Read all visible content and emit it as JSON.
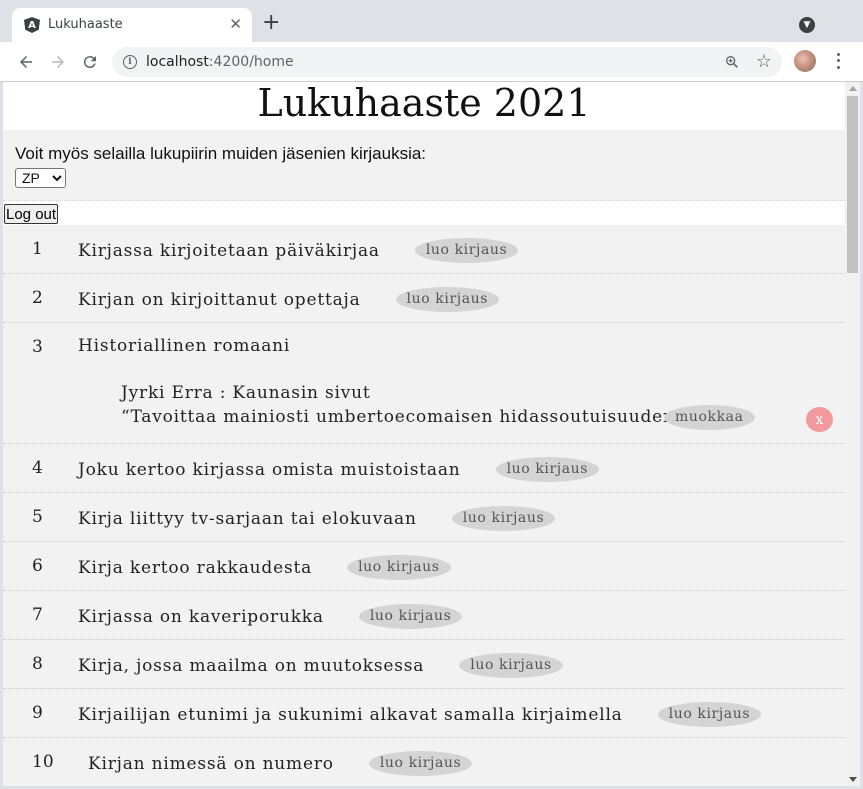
{
  "browser": {
    "tab_title": "Lukuhaaste",
    "tab_favicon": "A",
    "url_host": "localhost",
    "url_path": ":4200/home"
  },
  "page": {
    "title": "Lukuhaaste 2021",
    "intro_text": "Voit myös selailla lukupiirin muiden jäsenien kirjauksia:",
    "member_select": {
      "selected": "ZP",
      "options": [
        "ZP"
      ]
    },
    "logout_label": "Log out",
    "create_label": "luo kirjaus",
    "edit_label": "muokkaa",
    "delete_label": "x"
  },
  "challenges": [
    {
      "num": "1",
      "title": "Kirjassa kirjoitetaan päiväkirjaa"
    },
    {
      "num": "2",
      "title": "Kirjan on kirjoittanut opettaja"
    },
    {
      "num": "3",
      "title": "Historiallinen romaani",
      "entry": {
        "author_book": "Jyrki Erra : Kaunasin sivut",
        "quote": "“Tavoittaa mainiosti umbertoecomaisen hidassoutuisuuden.”"
      }
    },
    {
      "num": "4",
      "title": "Joku kertoo kirjassa omista muistoistaan"
    },
    {
      "num": "5",
      "title": "Kirja liittyy tv-sarjaan tai elokuvaan"
    },
    {
      "num": "6",
      "title": "Kirja kertoo rakkaudesta"
    },
    {
      "num": "7",
      "title": "Kirjassa on kaveriporukka"
    },
    {
      "num": "8",
      "title": "Kirja, jossa maailma on muutoksessa"
    },
    {
      "num": "9",
      "title": "Kirjailijan etunimi ja sukunimi alkavat samalla kirjaimella"
    },
    {
      "num": "10",
      "title": "Kirjan nimessä on numero"
    }
  ]
}
